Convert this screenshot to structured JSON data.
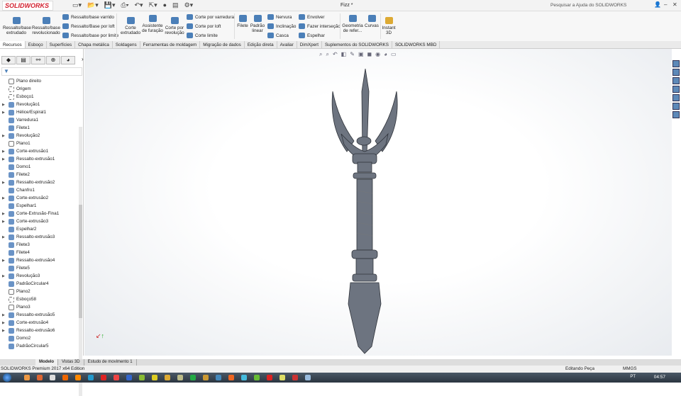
{
  "app": {
    "logo": "SOLIDWORKS",
    "title": "Fizz *",
    "search_placeholder": "Pesquisar a Ajuda do SOLIDWORKS"
  },
  "ribbon": {
    "large": [
      "Ressalto/base extrudado",
      "Ressalto/base revolucionado",
      "Corte extrudado",
      "Assistente de furação",
      "Corte por revolução",
      "Filete",
      "Padrão linear",
      "Geometria de refer...",
      "Curvas",
      "Instant 3D"
    ],
    "small": [
      "Ressalto/base varrido",
      "Ressalto/Base por loft",
      "Ressalto/base por limite",
      "Corte por varredura",
      "Corte por loft",
      "Corte limite",
      "Nervura",
      "Inclinação",
      "Casca",
      "Envolver",
      "Fazer interseção",
      "Espelhar"
    ]
  },
  "tabs": [
    "Recursos",
    "Esboço",
    "Superfícies",
    "Chapa metálica",
    "Soldagens",
    "Ferramentas de moldagem",
    "Migração de dados",
    "Edição direta",
    "Avaliar",
    "DimXpert",
    "Suplementos do SOLIDWORKS",
    "SOLIDWORKS MBD"
  ],
  "tree": [
    {
      "label": "Plano direito",
      "icon": "plane",
      "exp": false
    },
    {
      "label": "Origem",
      "icon": "origin",
      "exp": false
    },
    {
      "label": "Esboço1",
      "icon": "sketch",
      "exp": false
    },
    {
      "label": "Revolução1",
      "icon": "feature",
      "exp": true
    },
    {
      "label": "Hélice/Espiral1",
      "icon": "feature",
      "exp": true
    },
    {
      "label": "Varredura1",
      "icon": "feature",
      "exp": false
    },
    {
      "label": "Filete1",
      "icon": "feature",
      "exp": false
    },
    {
      "label": "Revolução2",
      "icon": "feature",
      "exp": true
    },
    {
      "label": "Plano1",
      "icon": "plane",
      "exp": false
    },
    {
      "label": "Corte-extrusão1",
      "icon": "feature",
      "exp": true
    },
    {
      "label": "Ressalto-extrusão1",
      "icon": "feature",
      "exp": true
    },
    {
      "label": "Domo1",
      "icon": "feature",
      "exp": false
    },
    {
      "label": "Filete2",
      "icon": "feature",
      "exp": false
    },
    {
      "label": "Ressalto-extrusão2",
      "icon": "feature",
      "exp": true
    },
    {
      "label": "Chanfro1",
      "icon": "feature",
      "exp": false
    },
    {
      "label": "Corte-extrusão2",
      "icon": "feature",
      "exp": true
    },
    {
      "label": "Espelhar1",
      "icon": "feature",
      "exp": false
    },
    {
      "label": "Corte-Extrusão-Fina1",
      "icon": "feature",
      "exp": true
    },
    {
      "label": "Corte-extrusão3",
      "icon": "feature",
      "exp": true
    },
    {
      "label": "Espelhar2",
      "icon": "feature",
      "exp": false
    },
    {
      "label": "Ressalto-extrusão3",
      "icon": "feature",
      "exp": true
    },
    {
      "label": "Filete3",
      "icon": "feature",
      "exp": false
    },
    {
      "label": "Filete4",
      "icon": "feature",
      "exp": false
    },
    {
      "label": "Ressalto-extrusão4",
      "icon": "feature",
      "exp": true
    },
    {
      "label": "Filete5",
      "icon": "feature",
      "exp": false
    },
    {
      "label": "Revolução3",
      "icon": "feature",
      "exp": true
    },
    {
      "label": "PadrãoCircular4",
      "icon": "feature",
      "exp": false
    },
    {
      "label": "Plano2",
      "icon": "plane",
      "exp": false
    },
    {
      "label": "Esboço58",
      "icon": "sketch",
      "exp": false
    },
    {
      "label": "Plano3",
      "icon": "plane",
      "exp": false
    },
    {
      "label": "Ressalto-extrusão5",
      "icon": "feature",
      "exp": true
    },
    {
      "label": "Corte-extrusão4",
      "icon": "feature",
      "exp": true
    },
    {
      "label": "Ressalto-extrusão6",
      "icon": "feature",
      "exp": true
    },
    {
      "label": "Domo2",
      "icon": "feature",
      "exp": false
    },
    {
      "label": "PadrãoCircular5",
      "icon": "feature",
      "exp": false
    }
  ],
  "bottom_tabs": [
    "Modelo",
    "Vistas 3D",
    "Estudo de movimento 1"
  ],
  "status": {
    "left": "SOLIDWORKS Premium 2017 x64 Edition",
    "mode": "Editando Peça",
    "units": "MMGS"
  },
  "taskbar": {
    "lang": "PT",
    "time": "04:57",
    "colors": [
      "#e94",
      "#d63",
      "#ddd",
      "#e60",
      "#f80",
      "#29c",
      "#d22",
      "#e44",
      "#36c",
      "#8b3",
      "#dc2",
      "#da3",
      "#bb8",
      "#2a4",
      "#c93",
      "#48b",
      "#e62",
      "#4bd",
      "#6b3",
      "#d22",
      "#dd6",
      "#c33",
      "#9bd"
    ]
  }
}
